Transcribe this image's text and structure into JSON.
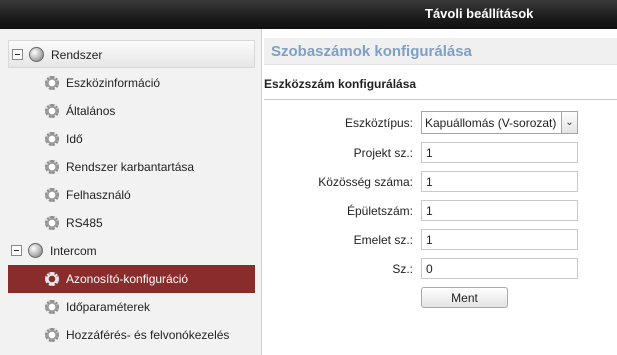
{
  "window": {
    "title": "Távoli beállítások"
  },
  "sidebar": {
    "groups": [
      {
        "label": "Rendszer",
        "icon": "globe-icon",
        "items": [
          {
            "label": "Eszközinformáció",
            "icon": "gear-icon"
          },
          {
            "label": "Általános",
            "icon": "gear-icon"
          },
          {
            "label": "Idő",
            "icon": "gear-icon"
          },
          {
            "label": "Rendszer karbantartása",
            "icon": "gear-icon"
          },
          {
            "label": "Felhasználó",
            "icon": "gear-icon"
          },
          {
            "label": "RS485",
            "icon": "gear-icon"
          }
        ]
      },
      {
        "label": "Intercom",
        "icon": "globe-icon",
        "items": [
          {
            "label": "Azonosító-konfiguráció",
            "icon": "gear-icon",
            "selected": true
          },
          {
            "label": "Időparaméterek",
            "icon": "gear-icon"
          },
          {
            "label": "Hozzáférés- és felvonókezelés",
            "icon": "gear-icon"
          }
        ]
      }
    ],
    "selected_color": "#8a2c2c"
  },
  "main": {
    "section_title": "Szobaszámok konfigurálása",
    "subheading": "Eszközszám konfigurálása",
    "form": {
      "device_type": {
        "label": "Eszköztípus:",
        "value": "Kapuállomás (V-sorozat)"
      },
      "project_no": {
        "label": "Projekt sz.:",
        "value": "1"
      },
      "community_no": {
        "label": "Közösség száma:",
        "value": "1"
      },
      "building_no": {
        "label": "Épületszám:",
        "value": "1"
      },
      "floor_no": {
        "label": "Emelet sz.:",
        "value": "1"
      },
      "no": {
        "label": "Sz.:",
        "value": "0"
      }
    },
    "save_label": "Ment"
  },
  "colors": {
    "header_text": "#7f9fc4",
    "titlebar": "#1c1c1c"
  }
}
